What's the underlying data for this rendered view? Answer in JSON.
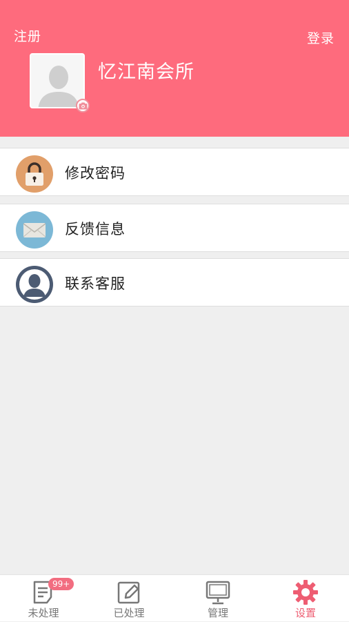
{
  "header": {
    "register_label": "注册",
    "login_label": "登录",
    "club_name": "忆江南会所",
    "bg_color": "#fe6b7d"
  },
  "menu": [
    {
      "label": "修改密码",
      "icon": "lock-icon",
      "icon_bg": "#e19f6a"
    },
    {
      "label": "反馈信息",
      "icon": "mail-icon",
      "icon_bg": "#7cb8d6"
    },
    {
      "label": "联系客服",
      "icon": "person-icon",
      "icon_bg": "#4c5b73"
    }
  ],
  "tabbar": {
    "tabs": [
      {
        "label": "未处理",
        "icon": "document-icon",
        "badge": "99+"
      },
      {
        "label": "已处理",
        "icon": "edit-icon"
      },
      {
        "label": "管理",
        "icon": "monitor-icon"
      },
      {
        "label": "设置",
        "icon": "gear-icon",
        "active": true
      }
    ],
    "active_color": "#ee5d72"
  }
}
